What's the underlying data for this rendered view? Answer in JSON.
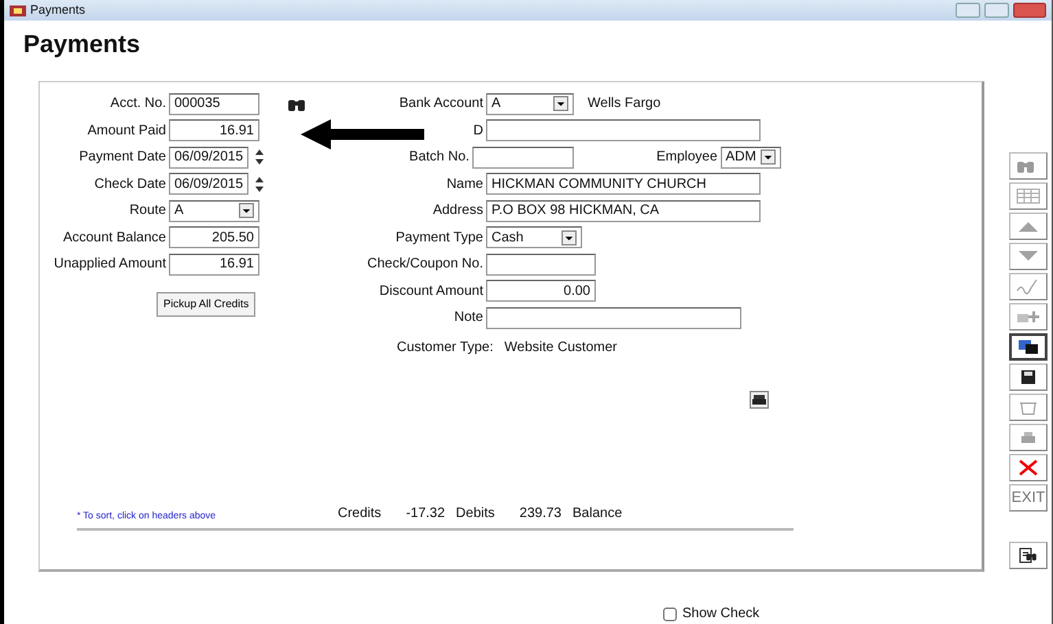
{
  "window": {
    "title": "Payments"
  },
  "heading": "Payments",
  "left_fields": [
    {
      "label": "Acct. No.",
      "value": "000035",
      "kind": "text",
      "lookup": true
    },
    {
      "label": "Amount Paid",
      "value": "16.91",
      "kind": "number"
    },
    {
      "label": "Payment Date",
      "value": "06/09/2015",
      "kind": "spin"
    },
    {
      "label": "Check Date",
      "value": "06/09/2015",
      "kind": "spin"
    },
    {
      "label": "Route",
      "value": "A",
      "kind": "select"
    },
    {
      "label": "Account Balance",
      "value": "205.50",
      "kind": "number"
    },
    {
      "label": "Unapplied Amount",
      "value": "16.91",
      "kind": "number"
    }
  ],
  "pickup_button": "Pickup All Credits",
  "right_fields": [
    {
      "label": "Bank Account",
      "value": "A",
      "kind": "select",
      "extra": "Wells Fargo"
    },
    {
      "label": "D",
      "kind": "wide",
      "arrow": true
    },
    {
      "label": "Batch No.",
      "kind": "text",
      "employee": {
        "label": "Employee",
        "value": "ADM"
      }
    },
    {
      "label": "Name",
      "value": "HICKMAN COMMUNITY CHURCH",
      "kind": "wide"
    },
    {
      "label": "Address",
      "value": "P.O BOX  98 HICKMAN, CA",
      "kind": "wide"
    },
    {
      "label": "Payment Type",
      "value": "Cash",
      "kind": "select"
    },
    {
      "label": "Check/Coupon No.",
      "kind": "text"
    },
    {
      "label": "Discount Amount",
      "value": "0.00",
      "kind": "number"
    },
    {
      "label": "Note",
      "kind": "note"
    }
  ],
  "customer_type": {
    "label": "Customer Type:",
    "value": "Website Customer"
  },
  "sort_hint": "* To sort, click on headers above",
  "totals": [
    {
      "label": "Credits",
      "value": "-17.32"
    },
    {
      "label": "Debits",
      "value": "239.73"
    },
    {
      "label": "Balance"
    }
  ],
  "show_check": {
    "label": "Show Check",
    "checked": false
  },
  "toolbar": [
    {
      "kind": "find",
      "disabled": true
    },
    {
      "kind": "grid",
      "disabled": true
    },
    {
      "kind": "up",
      "disabled": true
    },
    {
      "kind": "down",
      "disabled": true
    },
    {
      "kind": "sign",
      "disabled": true
    },
    {
      "kind": "add",
      "disabled": true
    },
    {
      "kind": "copy",
      "disabled": false
    },
    {
      "kind": "save",
      "disabled": false
    },
    {
      "kind": "trash",
      "disabled": true
    },
    {
      "kind": "print",
      "disabled": true
    },
    {
      "kind": "delete",
      "disabled": false
    },
    {
      "kind": "exit",
      "label": "EXIT",
      "disabled": true
    }
  ],
  "report_button": {
    "kind": "report",
    "disabled": false
  }
}
